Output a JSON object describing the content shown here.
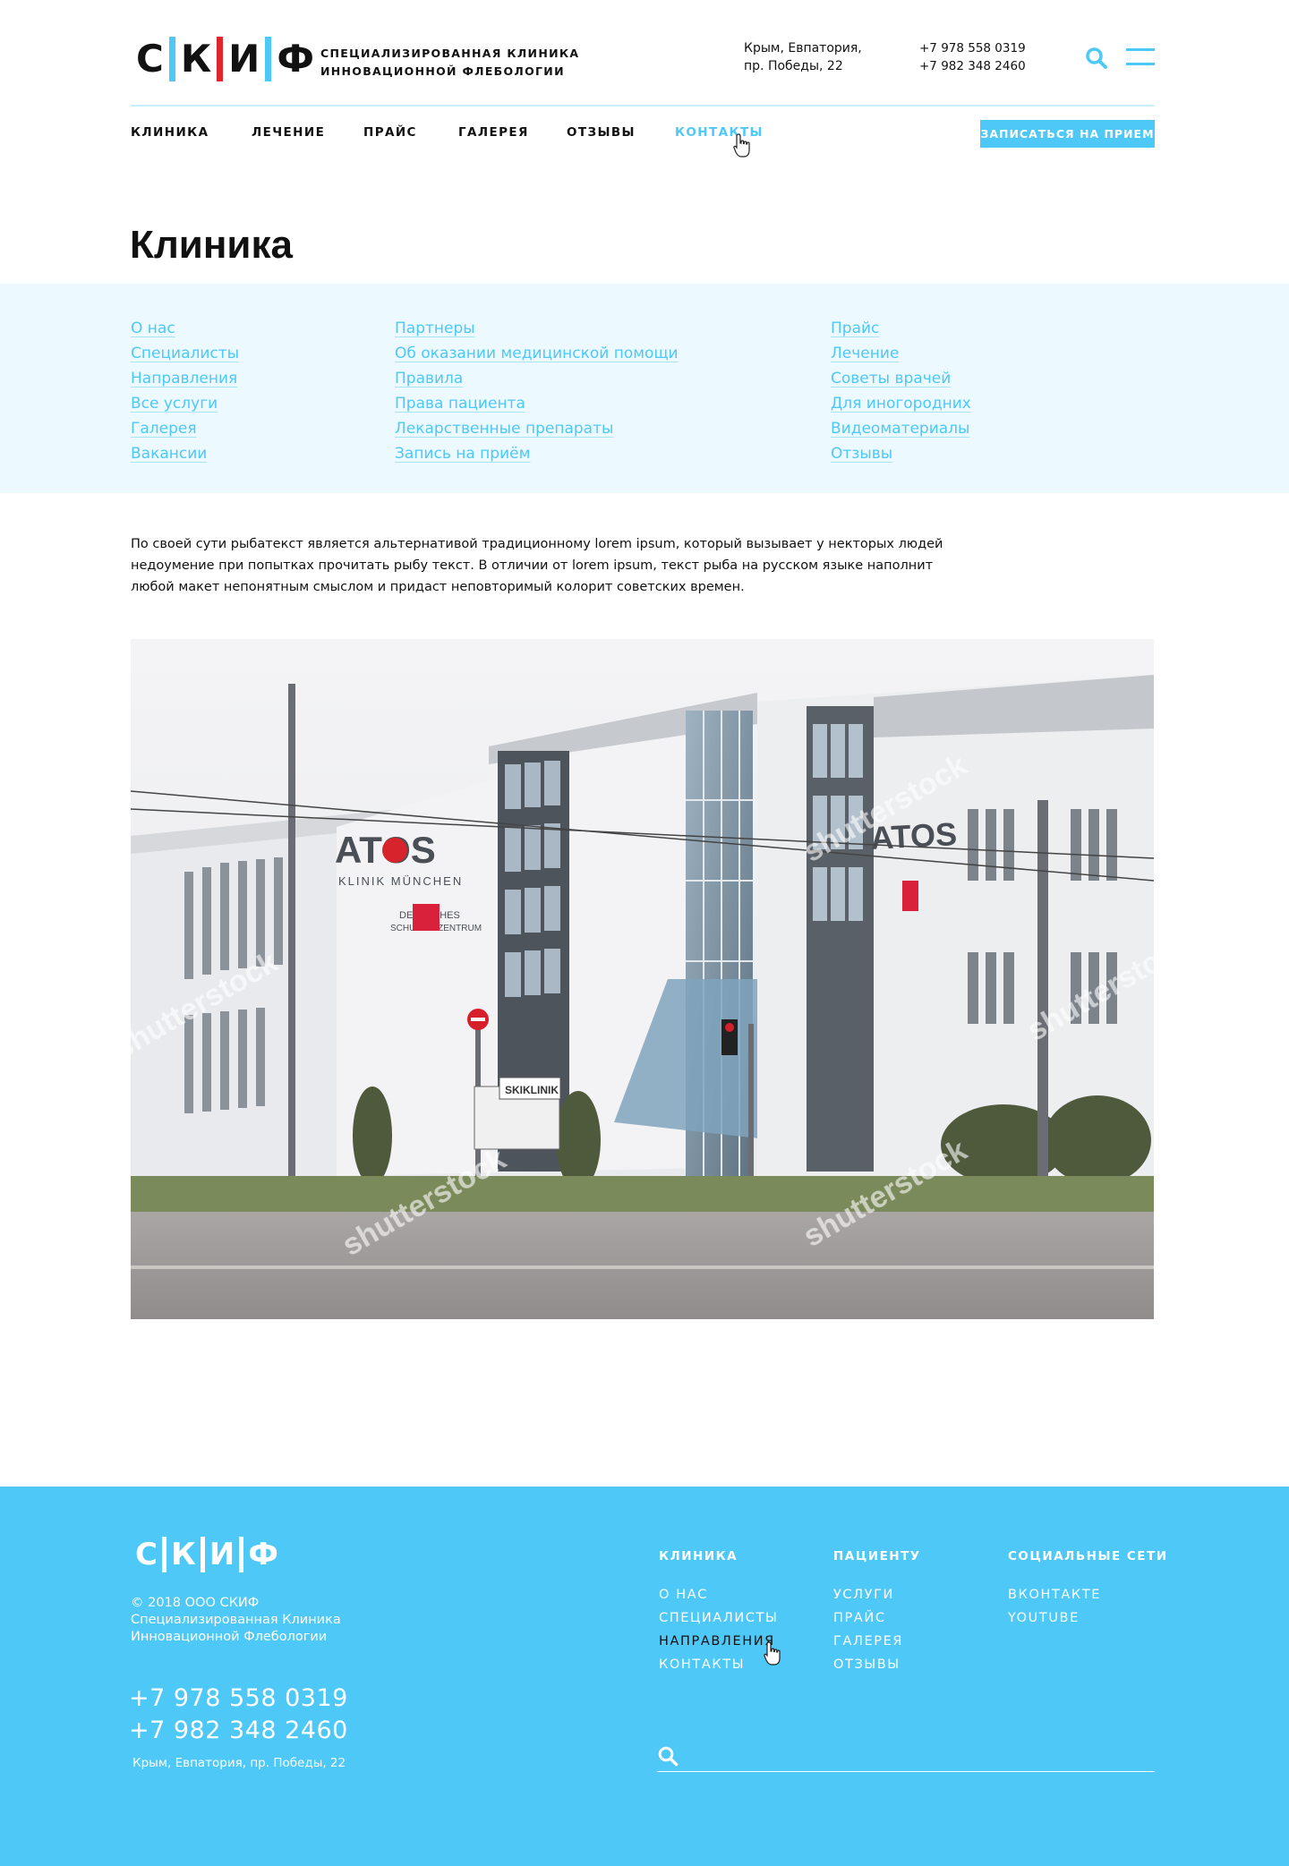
{
  "brand": {
    "letters": [
      "С",
      "К",
      "И",
      "Ф"
    ],
    "subtitle_line1": "Специализированная клиника",
    "subtitle_line2": "инновационной флебологии",
    "accent_color": "#4ec8f7",
    "red_color": "#e0262a"
  },
  "header": {
    "address_line1": "Крым, Евпатория,",
    "address_line2": "пр. Победы, 22",
    "phone1": "+7 978 558 0319",
    "phone2": "+7 982 348 2460",
    "search_icon": "search-icon",
    "menu_icon": "hamburger-icon"
  },
  "nav": {
    "items": [
      "Клиника",
      "Лечение",
      "Прайс",
      "Галерея",
      "Отзывы",
      "Контакты"
    ],
    "active": "Контакты",
    "cta": "Записаться на прием"
  },
  "page": {
    "title": "Клиника",
    "links_col1": [
      "О нас",
      "Специалисты",
      "Направления",
      "Все услуги",
      "Галерея",
      "Вакансии"
    ],
    "links_col2": [
      "Партнеры",
      "Об оказании медицинской помощи",
      "Правила",
      "Права пациента",
      "Лекарственные препараты",
      "Запись на приём"
    ],
    "links_col3": [
      "Прайс",
      "Лечение",
      "Советы врачей",
      "Для иногородних",
      "Видеоматериалы",
      "Отзывы"
    ],
    "lead": "По своей сути рыбатекст является альтернативой традиционному lorem ipsum, который вызывает у некторых людей недоумение при попытках прочитать рыбу текст. В отличии от lorem ipsum, текст рыба на русском языке наполнит любой макет непонятным смыслом и придаст неповторимый колорит советских времен.",
    "photo": {
      "sign_main": "ATOS",
      "sign_sub": "KLINIK MÜNCHEN",
      "sign_small_line1": "DEUTSCHES",
      "sign_small_line2": "SCHULTERZENTRUM",
      "sign_street": "SKIKLINIK",
      "watermark": "shutterstock"
    }
  },
  "footer": {
    "letters": [
      "С",
      "К",
      "И",
      "Ф"
    ],
    "copy_line1": "© 2018 ООО СКИФ",
    "copy_line2": "Специализированная Клиника",
    "copy_line3": "Инновационной Флебологии",
    "phone1": "+7 978 558 0319",
    "phone2": "+7 982 348 2460",
    "address": "Крым, Евпатория, пр. Победы, 22",
    "col1_title": "Клиника",
    "col1_items": [
      "О нас",
      "Специалисты",
      "Направления",
      "Контакты"
    ],
    "col2_title": "Пациенту",
    "col2_items": [
      "Услуги",
      "Прайс",
      "Галерея",
      "Отзывы"
    ],
    "col3_title": "Социальные сети",
    "col3_items": [
      "Вконтакте",
      "YouTube"
    ],
    "search_placeholder": ""
  }
}
